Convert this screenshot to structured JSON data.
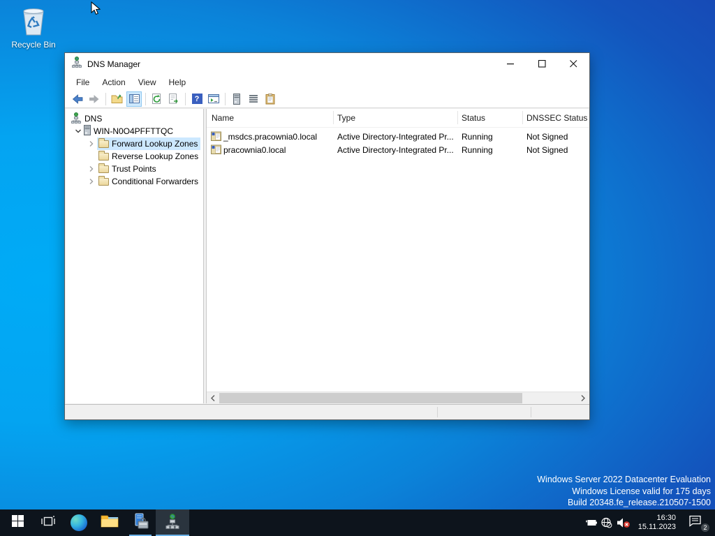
{
  "desktop": {
    "recycle_bin_label": "Recycle Bin",
    "system_info_lines": [
      "Windows Server 2022 Datacenter Evaluation",
      "Windows License valid for 175 days",
      "Build 20348.fe_release.210507-1500"
    ]
  },
  "window": {
    "title": "DNS Manager",
    "menu_items": [
      "File",
      "Action",
      "View",
      "Help"
    ],
    "toolbar_icons": [
      "back-icon",
      "forward-icon",
      "up-folder-icon",
      "show-console-tree-icon",
      "refresh-icon",
      "export-list-icon",
      "help-icon",
      "console-window-icon",
      "server-column-icon",
      "list-icon",
      "clipboard-icon"
    ],
    "tree": {
      "root_label": "DNS",
      "server_label": "WIN-N0O4PFFTTQC",
      "children": [
        {
          "label": "Forward Lookup Zones",
          "selected": true
        },
        {
          "label": "Reverse Lookup Zones",
          "selected": false
        },
        {
          "label": "Trust Points",
          "selected": false
        },
        {
          "label": "Conditional Forwarders",
          "selected": false
        }
      ]
    },
    "list": {
      "columns": [
        "Name",
        "Type",
        "Status",
        "DNSSEC Status"
      ],
      "rows": [
        {
          "name": "_msdcs.pracownia0.local",
          "type": "Active Directory-Integrated Pr...",
          "status": "Running",
          "dnssec": "Not Signed"
        },
        {
          "name": "pracownia0.local",
          "type": "Active Directory-Integrated Pr...",
          "status": "Running",
          "dnssec": "Not Signed"
        }
      ]
    }
  },
  "taskbar": {
    "clock": {
      "time": "16:30",
      "date": "15.11.2023"
    },
    "notification_badge": "2",
    "icons": [
      "start-icon",
      "task-view-icon",
      "edge-icon",
      "file-explorer-icon",
      "server-manager-icon",
      "dns-manager-icon",
      "battery-icon",
      "network-icon",
      "volume-muted-icon",
      "action-center-icon"
    ]
  },
  "colors": {
    "selection": "#cce8ff",
    "accent": "#0078d7",
    "taskbar": "#0d141c",
    "desktop_light": "#00a7f5",
    "desktop_dark": "#1a41b0"
  }
}
